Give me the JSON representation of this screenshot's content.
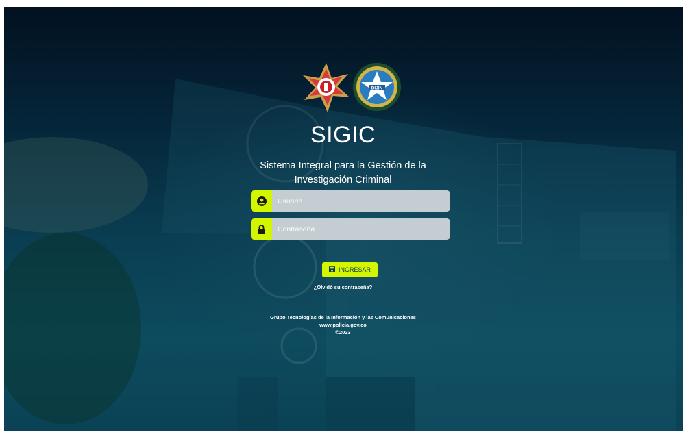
{
  "app": {
    "title": "SIGIC",
    "subtitle_line1": "Sistema Integral para la Gestión de la",
    "subtitle_line2": "Investigación Criminal"
  },
  "logos": {
    "left": "star-badge",
    "right_text": "DIJIN"
  },
  "form": {
    "username_placeholder": "Usuario",
    "username_value": "",
    "username_icon": "user-circle-icon",
    "password_placeholder": "Contraseña",
    "password_value": "",
    "password_icon": "lock-icon",
    "submit_label": "INGRESAR",
    "submit_icon": "save-icon",
    "forgot_label": "¿Olvidó su contraseña?"
  },
  "footer": {
    "line1": "Grupo Tecnologías de la Información y las Comunicaciones",
    "line2": "www.policia.gov.co",
    "line3": "©2023"
  },
  "colors": {
    "accent": "#d4f500",
    "input_bg": "#c4cdd1",
    "bg_dark": "#021120",
    "bg_teal": "#0d4b5e"
  }
}
